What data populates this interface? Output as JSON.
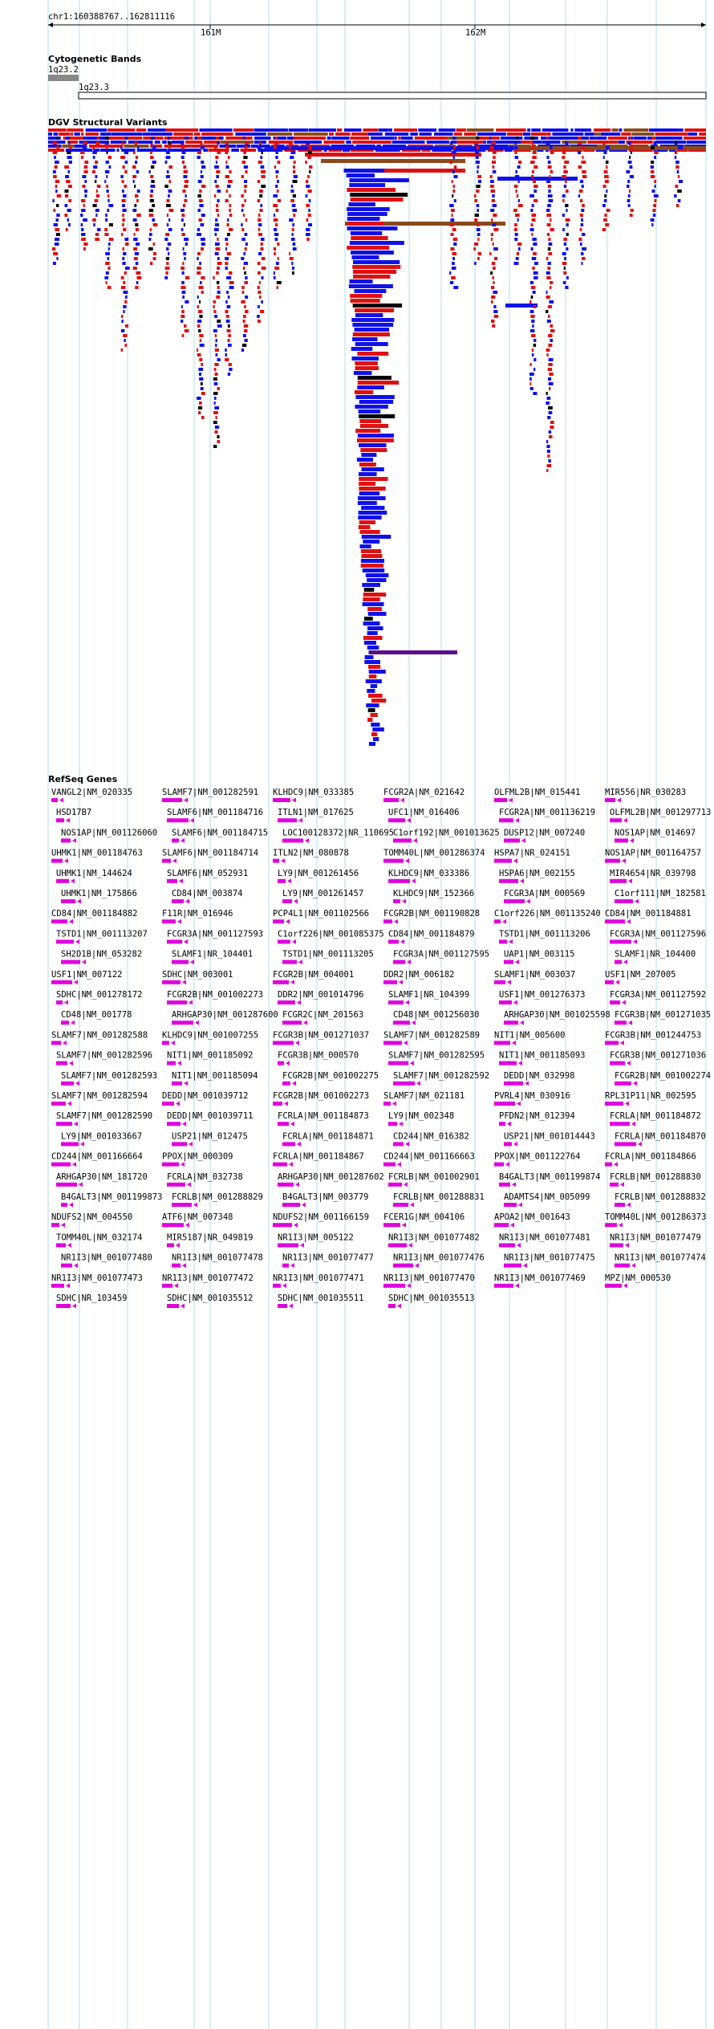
{
  "location": "chr1:160388767..162811116",
  "ruler": {
    "ticks": [
      {
        "label": "161M"
      },
      {
        "label": "162M"
      }
    ]
  },
  "tracks": {
    "cytoband": {
      "title": "Cytogenetic Bands",
      "bands": [
        {
          "name": "1q23.2"
        },
        {
          "name": "1q23.3"
        }
      ]
    },
    "dgv": {
      "title": "DGV Structural Variants"
    },
    "refseq": {
      "title": "RefSeq Genes"
    }
  },
  "genes": [
    "VANGL2|NM_020335",
    "SLAMF7|NM_001282591",
    "KLHDC9|NM_033385",
    "FCGR2A|NM_021642",
    "OLFML2B|NM_015441",
    "MIR556|NR_030283",
    "HSD17B7",
    "SLAMF6|NM_001184716",
    "ITLN1|NM_017625",
    "UFC1|NM_016406",
    "FCGR2A|NM_001136219",
    "OLFML2B|NM_001297713",
    "NOS1AP|NM_001126060",
    "SLAMF6|NM_001184715",
    "LOC100128372|NR_110695",
    "C1orf192|NM_001013625",
    "DUSP12|NM_007240",
    "NOS1AP|NM_014697",
    "UHMK1|NM_001184763",
    "SLAMF6|NM_001184714",
    "ITLN2|NM_080878",
    "TOMM40L|NM_001286374",
    "HSPA7|NR_024151",
    "NOS1AP|NM_001164757",
    "UHMK1|NM_144624",
    "SLAMF6|NM_052931",
    "LY9|NM_001261456",
    "KLHDC9|NM_033386",
    "HSPA6|NM_002155",
    "MIR4654|NR_039798",
    "UHMK1|NM_175866",
    "CD84|NM_003874",
    "LY9|NM_001261457",
    "KLHDC9|NM_152366",
    "FCGR3A|NM_000569",
    "C1orf111|NM_182581",
    "CD84|NM_001184882",
    "F11R|NM_016946",
    "PCP4L1|NM_001102566",
    "FCGR2B|NM_001190828",
    "C1orf226|NM_001135240",
    "CD84|NM_001184881",
    "TSTD1|NM_001113207",
    "FCGR3A|NM_001127593",
    "C1orf226|NM_001085375",
    "CD84|NM_001184879",
    "TSTD1|NM_001113206",
    "FCGR3A|NM_001127596",
    "SH2D1B|NM_053282",
    "SLAMF1|NR_104401",
    "TSTD1|NM_001113205",
    "FCGR3A|NM_001127595",
    "UAP1|NM_003115",
    "SLAMF1|NR_104400",
    "USF1|NM_007122",
    "SDHC|NM_003001",
    "FCGR2B|NM_004001",
    "DDR2|NM_006182",
    "SLAMF1|NM_003037",
    "USF1|NM_207005",
    "SDHC|NM_001278172",
    "FCGR2B|NM_001002273",
    "DDR2|NM_001014796",
    "SLAMF1|NR_104399",
    "USF1|NM_001276373",
    "FCGR3A|NM_001127592",
    "CD48|NM_001778",
    "ARHGAP30|NM_001287600",
    "FCGR2C|NM_201563",
    "CD48|NM_001256030",
    "ARHGAP30|NM_001025598",
    "FCGR3B|NM_001271035",
    "SLAMF7|NM_001282588",
    "KLHDC9|NM_001007255",
    "FCGR3B|NM_001271037",
    "SLAMF7|NM_001282589",
    "NIT1|NM_005600",
    "FCGR3B|NM_001244753",
    "SLAMF7|NM_001282596",
    "NIT1|NM_001185092",
    "FCGR3B|NM_000570",
    "SLAMF7|NM_001282595",
    "NIT1|NM_001185093",
    "FCGR3B|NM_001271036",
    "SLAMF7|NM_001282593",
    "NIT1|NM_001185094",
    "FCGR2B|NM_001002275",
    "SLAMF7|NM_001282592",
    "DEDD|NM_032998",
    "FCGR2B|NM_001002274",
    "SLAMF7|NM_001282594",
    "DEDD|NM_001039712",
    "FCGR2B|NM_001002273",
    "SLAMF7|NM_021181",
    "PVRL4|NM_030916",
    "RPL31P11|NR_002595",
    "SLAMF7|NM_001282590",
    "DEDD|NM_001039711",
    "FCRLA|NM_001184873",
    "LY9|NM_002348",
    "PFDN2|NM_012394",
    "FCRLA|NM_001184872",
    "LY9|NM_001033667",
    "USP21|NM_012475",
    "FCRLA|NM_001184871",
    "CD244|NM_016382",
    "USP21|NM_001014443",
    "FCRLA|NM_001184870",
    "CD244|NM_001166664",
    "PPOX|NM_000309",
    "FCRLA|NM_001184867",
    "CD244|NM_001166663",
    "PPOX|NM_001122764",
    "FCRLA|NM_001184866",
    "ARHGAP30|NM_181720",
    "FCRLA|NM_032738",
    "ARHGAP30|NM_001287602",
    "FCRLB|NM_001002901",
    "B4GALT3|NM_001199874",
    "FCRLB|NM_001288830",
    "B4GALT3|NM_001199873",
    "FCRLB|NM_001288829",
    "B4GALT3|NM_003779",
    "FCRLB|NM_001288831",
    "ADAMTS4|NM_005099",
    "FCRLB|NM_001288832",
    "NDUFS2|NM_004550",
    "ATF6|NM_007348",
    "NDUFS2|NM_001166159",
    "FCER1G|NM_004106",
    "APOA2|NM_001643",
    "TOMM40L|NM_001286373",
    "TOMM40L|NM_032174",
    "MIR5187|NR_049819",
    "NR1I3|NM_005122",
    "NR1I3|NM_001077482",
    "NR1I3|NM_001077481",
    "NR1I3|NM_001077479",
    "NR1I3|NM_001077480",
    "NR1I3|NM_001077478",
    "NR1I3|NM_001077477",
    "NR1I3|NM_001077476",
    "NR1I3|NM_001077475",
    "NR1I3|NM_001077474",
    "NR1I3|NM_001077473",
    "NR1I3|NM_001077472",
    "NR1I3|NM_001077471",
    "NR1I3|NM_001077470",
    "NR1I3|NM_001077469",
    "MPZ|NM_000530",
    "SDHC|NR_103459",
    "SDHC|NM_001035512",
    "SDHC|NM_001035511",
    "SDHC|NM_001035513"
  ],
  "colors": {
    "gain": "#e01010",
    "loss": "#1010e8",
    "complex": "#8a4a1a",
    "inversion": "#000000",
    "other": "#5a0f8a",
    "gene": "#e000e0",
    "cytoband": "#888888",
    "grid": "#b0dff0"
  },
  "icons": {
    "ruler_arrow": "double-arrow-icon",
    "strand": "arrow-icon"
  }
}
